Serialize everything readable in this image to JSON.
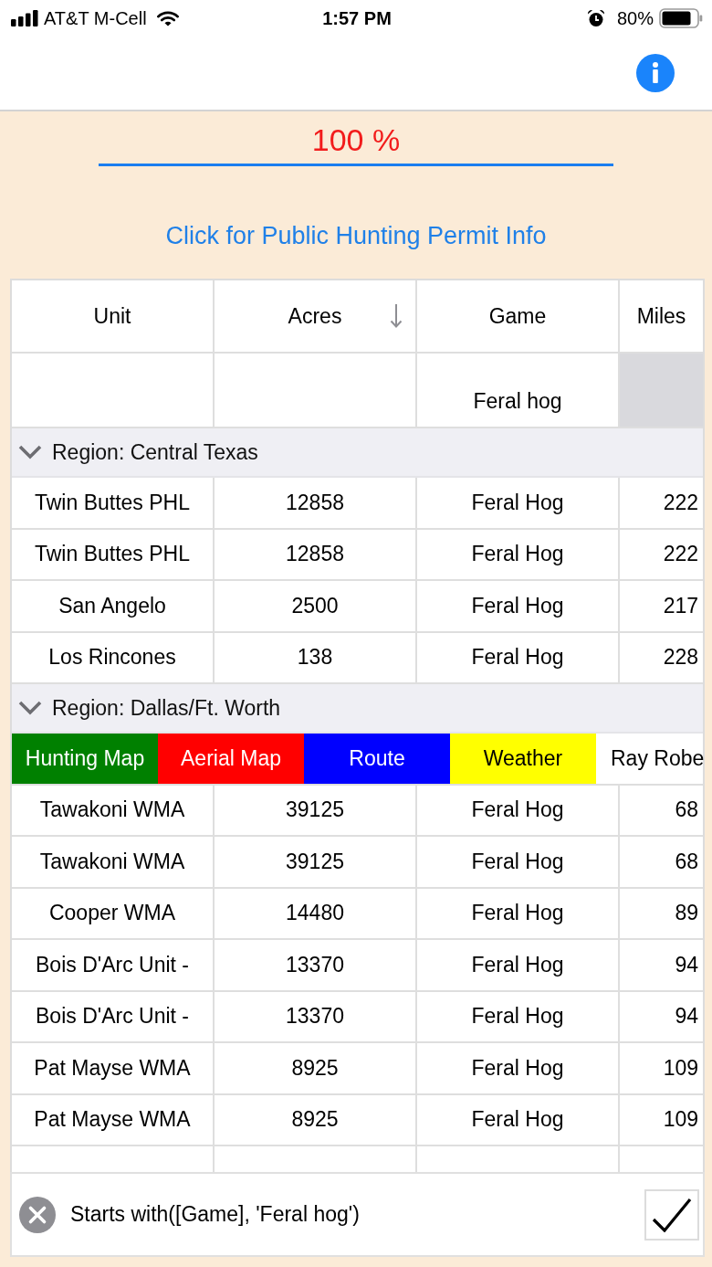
{
  "status_bar": {
    "carrier": "AT&T M-Cell",
    "time": "1:57 PM",
    "battery": "80%"
  },
  "progress": {
    "label": "100 %",
    "level": 1
  },
  "permit_link": "Click for Public Hunting Permit Info",
  "table": {
    "columns": [
      {
        "label": "Unit",
        "sorted": false
      },
      {
        "label": "Acres",
        "sorted": true
      },
      {
        "label": "Game",
        "sorted": false
      },
      {
        "label": "Miles",
        "sorted": false
      }
    ],
    "filters": [
      {
        "disabled": false
      },
      {
        "disabled": false
      },
      {
        "value": "Feral hog",
        "disabled": false
      },
      {
        "disabled": true
      }
    ],
    "groups": [
      {
        "title": "Region: Central Texas",
        "expanded": true,
        "rows": [
          {
            "kind": "data",
            "cells": [
              "Twin Buttes PHL",
              "12858",
              "Feral Hog",
              "222"
            ]
          },
          {
            "kind": "data",
            "cells": [
              "Twin Buttes PHL",
              "12858",
              "Feral Hog",
              "222"
            ]
          },
          {
            "kind": "data",
            "cells": [
              "San Angelo",
              "2500",
              "Feral Hog",
              "217"
            ]
          },
          {
            "kind": "data",
            "cells": [
              "Los Rincones",
              "138",
              "Feral Hog",
              "228"
            ]
          }
        ]
      },
      {
        "title": "Region: Dallas/Ft. Worth",
        "expanded": true,
        "rows": [
          {
            "kind": "swiped",
            "actions": [
              {
                "label": "Hunting Map",
                "color": "#008000"
              },
              {
                "label": "Aerial Map",
                "color": "#ff0000"
              },
              {
                "label": "Route",
                "color": "#0000ff"
              },
              {
                "label": "Weather",
                "color": "#ffff00"
              }
            ],
            "peek": "Ray Robe"
          },
          {
            "kind": "data",
            "cells": [
              "Tawakoni WMA",
              "39125",
              "Feral Hog",
              "68"
            ]
          },
          {
            "kind": "data",
            "cells": [
              "Tawakoni WMA",
              "39125",
              "Feral Hog",
              "68"
            ]
          },
          {
            "kind": "data",
            "cells": [
              "Cooper WMA",
              "14480",
              "Feral Hog",
              "89"
            ]
          },
          {
            "kind": "data",
            "cells": [
              "Bois D'Arc Unit -",
              "13370",
              "Feral Hog",
              "94"
            ]
          },
          {
            "kind": "data",
            "cells": [
              "Bois D'Arc Unit -",
              "13370",
              "Feral Hog",
              "94"
            ]
          },
          {
            "kind": "data",
            "cells": [
              "Pat Mayse WMA",
              "8925",
              "Feral Hog",
              "109"
            ]
          },
          {
            "kind": "data",
            "cells": [
              "Pat Mayse WMA",
              "8925",
              "Feral Hog",
              "109"
            ]
          }
        ]
      }
    ]
  },
  "filter_bar": {
    "expression": "Starts with([Game], 'Feral hog')"
  }
}
